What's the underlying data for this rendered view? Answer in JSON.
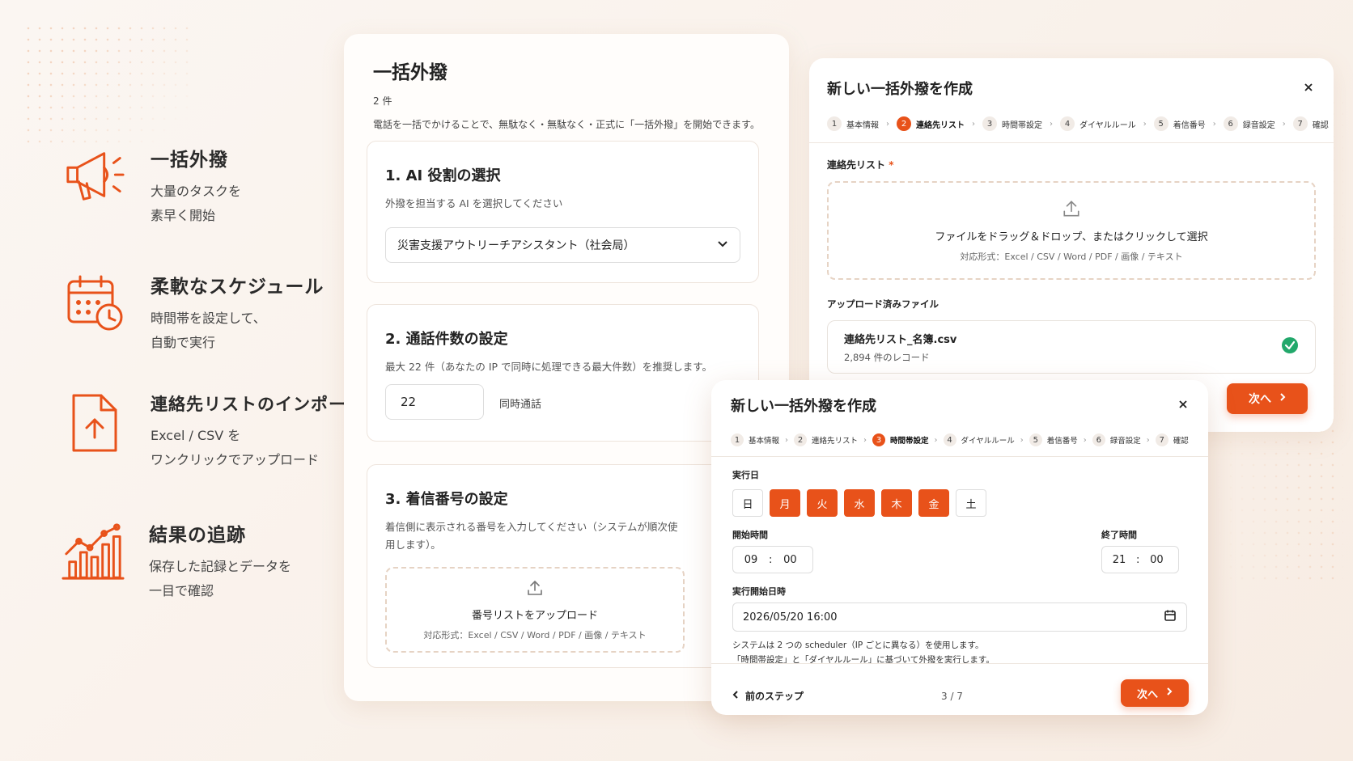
{
  "colors": {
    "accent": "#e8521a",
    "success": "#22a86b"
  },
  "features": [
    {
      "title": "一括外撥",
      "line1": "大量のタスクを",
      "line2": "素早く開始",
      "icon": "megaphone-icon"
    },
    {
      "title": "柔軟なスケジュール",
      "line1": "時間帯を設定して、",
      "line2": "自動で実行",
      "icon": "calendar-clock-icon"
    },
    {
      "title": "連絡先リストのインポート",
      "line1": "Excel / CSV を",
      "line2": "ワンクリックでアップロード",
      "icon": "file-upload-icon"
    },
    {
      "title": "結果の追跡",
      "line1": "保存した記録とデータを",
      "line2": "一目で確認",
      "icon": "chart-trend-icon"
    }
  ],
  "main": {
    "title": "一括外撥",
    "count": "2 件",
    "desc": "電話を一括でかけることで、無駄なく・無駄なく・正式に「一括外撥」を開始できます。",
    "s1": {
      "title": "1. AI 役割の選択",
      "sub": "外撥を担当する AI を選択してください",
      "value": "災害支援アウトリーチアシスタント（社会局）"
    },
    "s2": {
      "title": "2. 通話件数の設定",
      "sub": "最大 22 件（あなたの IP で同時に処理できる最大件数）を推奨します。",
      "value": "22",
      "unit": "同時通話"
    },
    "s3": {
      "title": "3. 着信番号の設定",
      "sub": "着信側に表示される番号を入力してください（システムが順次使用します）。",
      "upload": "番号リストをアップロード",
      "formats": "対応形式：Excel / CSV / Word / PDF / 画像 / テキスト"
    }
  },
  "modal1": {
    "title": "新しい一括外撥を作成",
    "steps": [
      {
        "n": "1",
        "label": "基本情報"
      },
      {
        "n": "2",
        "label": "連絡先リスト"
      },
      {
        "n": "3",
        "label": "時間帯設定"
      },
      {
        "n": "4",
        "label": "ダイヤルルール"
      },
      {
        "n": "5",
        "label": "着信番号"
      },
      {
        "n": "6",
        "label": "録音設定"
      },
      {
        "n": "7",
        "label": "確認"
      }
    ],
    "contact_label": "連絡先リスト",
    "required": "*",
    "drop_text": "ファイルをドラッグ＆ドロップ、またはクリックして選択",
    "drop_formats": "対応形式：Excel / CSV / Word / PDF / 画像 / テキスト",
    "uploaded_label": "アップロード済みファイル",
    "file_name": "連絡先リスト_名簿.csv",
    "file_meta": "2,894 件のレコード",
    "next": "次へ"
  },
  "modal2": {
    "title": "新しい一括外撥を作成",
    "run_day_label": "実行日",
    "days": [
      {
        "d": "日",
        "on": false
      },
      {
        "d": "月",
        "on": true
      },
      {
        "d": "火",
        "on": true
      },
      {
        "d": "水",
        "on": true
      },
      {
        "d": "木",
        "on": true
      },
      {
        "d": "金",
        "on": true
      },
      {
        "d": "土",
        "on": false
      }
    ],
    "start_label": "開始時間",
    "start_h": "09",
    "start_m": "00",
    "end_label": "終了時間",
    "end_h": "21",
    "end_m": "00",
    "colon": ":",
    "datetime_label": "実行開始日時",
    "datetime": "2026/05/20 16:00",
    "note1": "システムは 2 つの scheduler（IP ごとに異なる）を使用します。",
    "note2": "「時間帯設定」と「ダイヤルルール」に基づいて外撥を実行します。",
    "prev": "前のステップ",
    "page": "3 / 7",
    "next": "次へ"
  }
}
